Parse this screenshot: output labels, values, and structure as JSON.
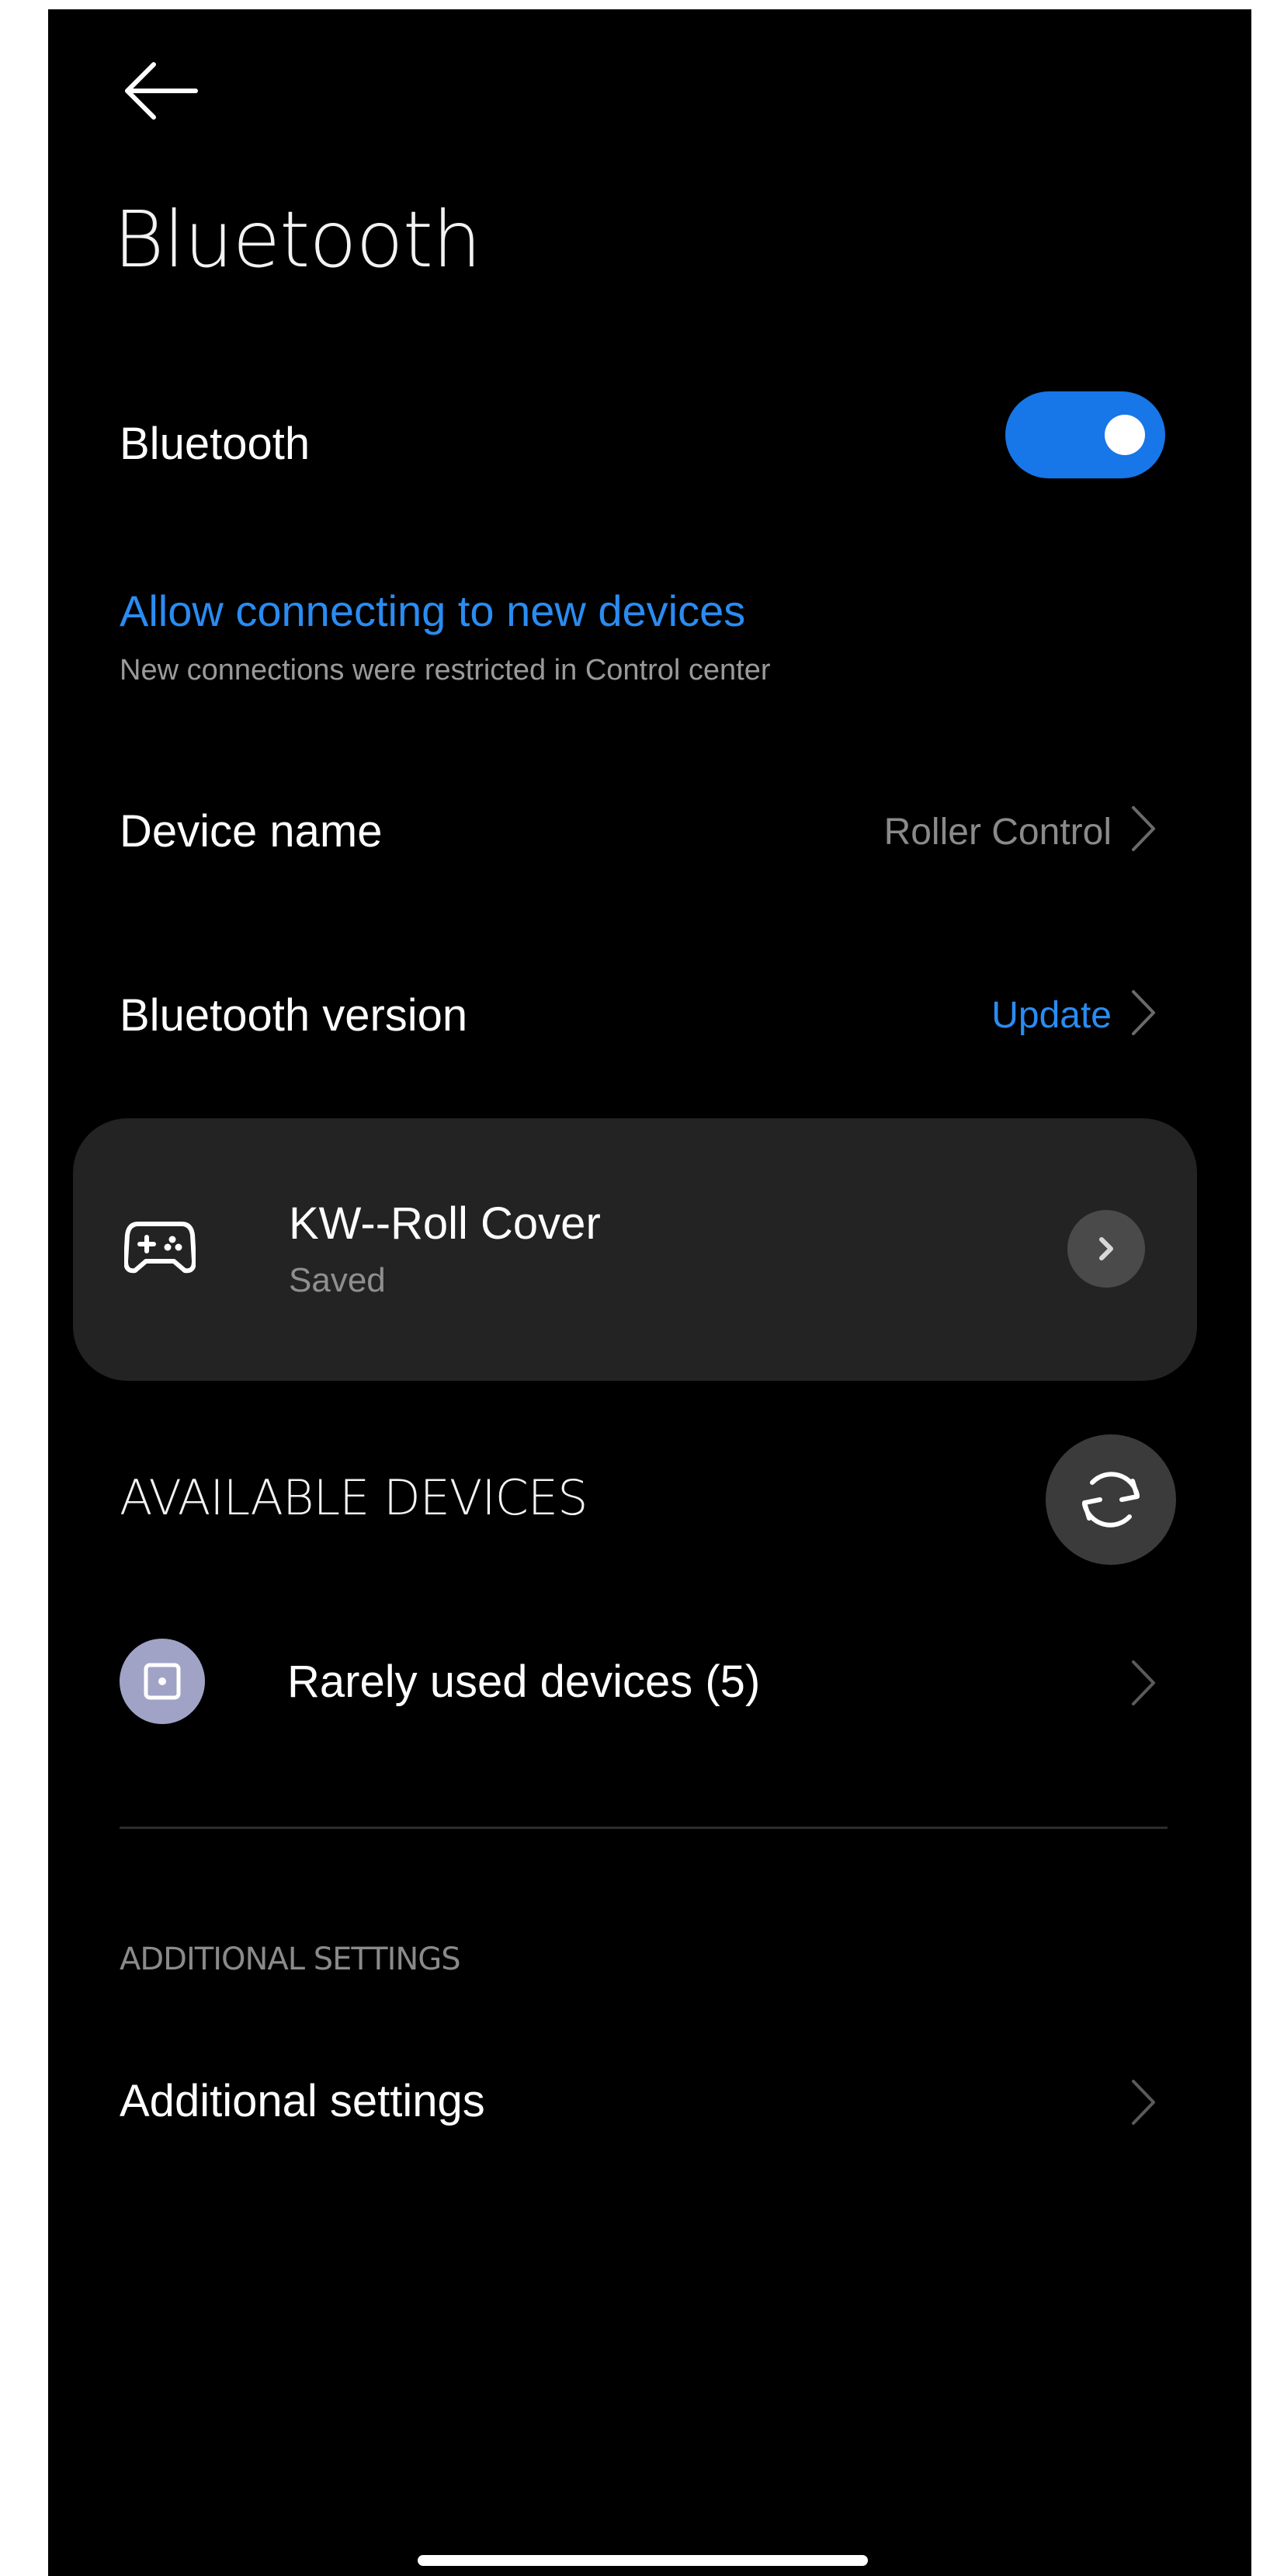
{
  "header": {
    "back_icon": "arrow-left-icon",
    "title": "Bluetooth"
  },
  "bluetooth_toggle": {
    "label": "Bluetooth",
    "enabled": true,
    "accent_color": "#1776e8"
  },
  "allow_connecting": {
    "title": "Allow connecting to new devices",
    "subtitle": "New connections were restricted in Control center",
    "color": "#2a8cf2"
  },
  "device_name": {
    "label": "Device name",
    "value": "Roller Control"
  },
  "bluetooth_version": {
    "label": "Bluetooth version",
    "value": "Update"
  },
  "saved_device": {
    "icon": "gamepad-icon",
    "name": "KW--Roll Cover",
    "status": "Saved"
  },
  "available_devices": {
    "header": "AVAILABLE DEVICES",
    "refresh_icon": "refresh-icon",
    "rarely_used": {
      "icon": "device-box-icon",
      "label": "Rarely used devices (5)",
      "icon_color": "#a0a3c6"
    }
  },
  "additional": {
    "header": "ADDITIONAL SETTINGS",
    "label": "Additional settings"
  }
}
